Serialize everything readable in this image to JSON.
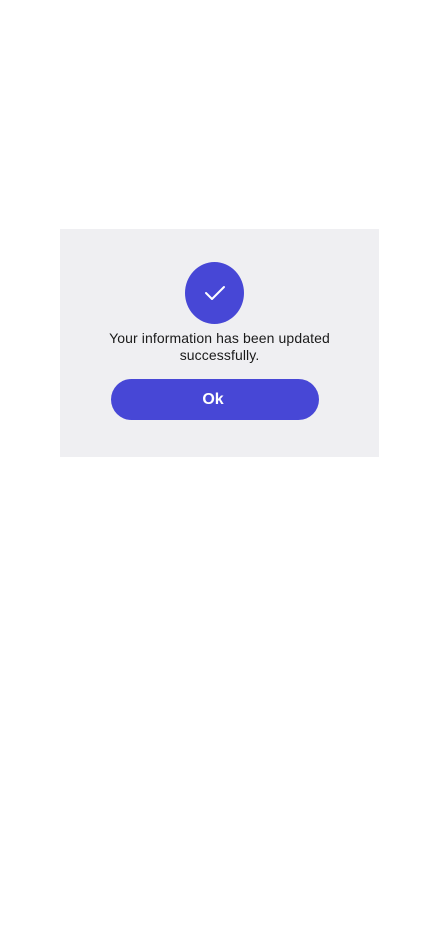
{
  "dialog": {
    "icon": "checkmark-icon",
    "message": "Your information has been updated successfully.",
    "ok_label": "Ok"
  },
  "colors": {
    "accent": "#4747d6",
    "dialog_background": "#efeff2",
    "page_background": "#ffffff",
    "text": "#1a1a1a",
    "button_text": "#ffffff"
  }
}
